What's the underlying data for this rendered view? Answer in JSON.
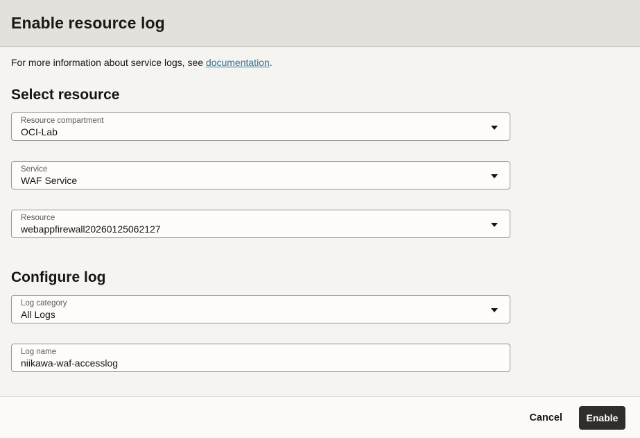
{
  "dialog": {
    "title": "Enable resource log",
    "intro": {
      "text_before_link": "For more information about service logs, see ",
      "link_text": "documentation",
      "text_after_link": "."
    },
    "sections": [
      {
        "heading": "Select resource",
        "fields": [
          {
            "label": "Resource compartment",
            "value": "OCI-Lab",
            "type": "dropdown"
          },
          {
            "label": "Service",
            "value": "WAF Service",
            "type": "dropdown"
          },
          {
            "label": "Resource",
            "value": "webappfirewall20260125062127",
            "type": "dropdown"
          }
        ]
      },
      {
        "heading": "Configure log",
        "fields": [
          {
            "label": "Log category",
            "value": "All Logs",
            "type": "dropdown"
          },
          {
            "label": "Log name",
            "value": "niikawa-waf-accesslog",
            "type": "text"
          }
        ]
      }
    ],
    "footer": {
      "cancel_label": "Cancel",
      "enable_label": "Enable"
    },
    "colors": {
      "header_bg": "#e4e1dd",
      "body_bg": "#f5f4f1",
      "footer_bg": "#fbfaf8",
      "field_bg": "#fdfcfb",
      "field_border": "#99948e",
      "text_primary": "#161513",
      "label_gray": "#5d5852",
      "link": "#2e7599",
      "enable_button_bg": "#312d2a",
      "enable_button_text": "#ffffff"
    }
  }
}
